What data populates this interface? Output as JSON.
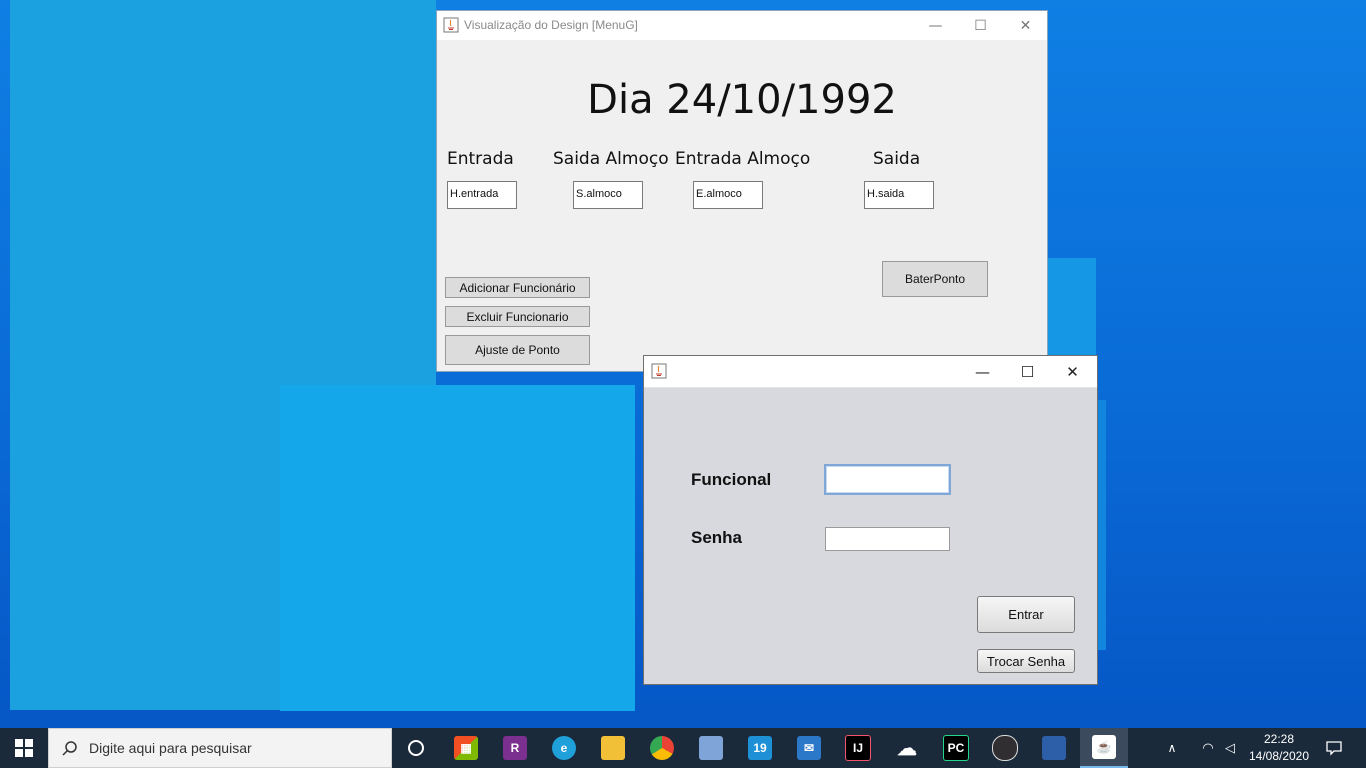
{
  "menu_window": {
    "title": "Visualização do Design [MenuG]",
    "date_heading": "Dia 24/10/1992",
    "columns": [
      {
        "label": "Entrada",
        "field_value": "H.entrada"
      },
      {
        "label": "Saida Almoço",
        "field_value": "S.almoco"
      },
      {
        "label": "Entrada Almoço",
        "field_value": "E.almoco"
      },
      {
        "label": "Saida",
        "field_value": "H.saida"
      }
    ],
    "buttons": {
      "add_employee": "Adicionar Funcionário",
      "delete_employee": "Excluir Funcionario",
      "adjust_punch": "Ajuste de Ponto",
      "punch": "BaterPonto"
    }
  },
  "login_window": {
    "title": "",
    "funcional_label": "Funcional",
    "funcional_value": "",
    "senha_label": "Senha",
    "senha_value": "",
    "enter_button": "Entrar",
    "change_password_button": "Trocar Senha"
  },
  "taskbar": {
    "search_placeholder": "Digite aqui para pesquisar",
    "time": "22:28",
    "date": "14/08/2020",
    "pinned_icons": [
      "store-icon",
      "winrar-icon",
      "edge-icon",
      "file-explorer-icon",
      "chrome-icon",
      "virtualbox-icon",
      "netbeans-icon",
      "mail-icon",
      "intellij-icon",
      "cloud-icon",
      "pycharm-icon",
      "obs-icon",
      "network-tool-icon",
      "java-icon"
    ]
  },
  "colors": {
    "desktop_blue": "#0a6fd8",
    "taskbar": "#1b2a3a",
    "window_bg": "#f0f0f0",
    "login_bg": "#d7d9df"
  }
}
